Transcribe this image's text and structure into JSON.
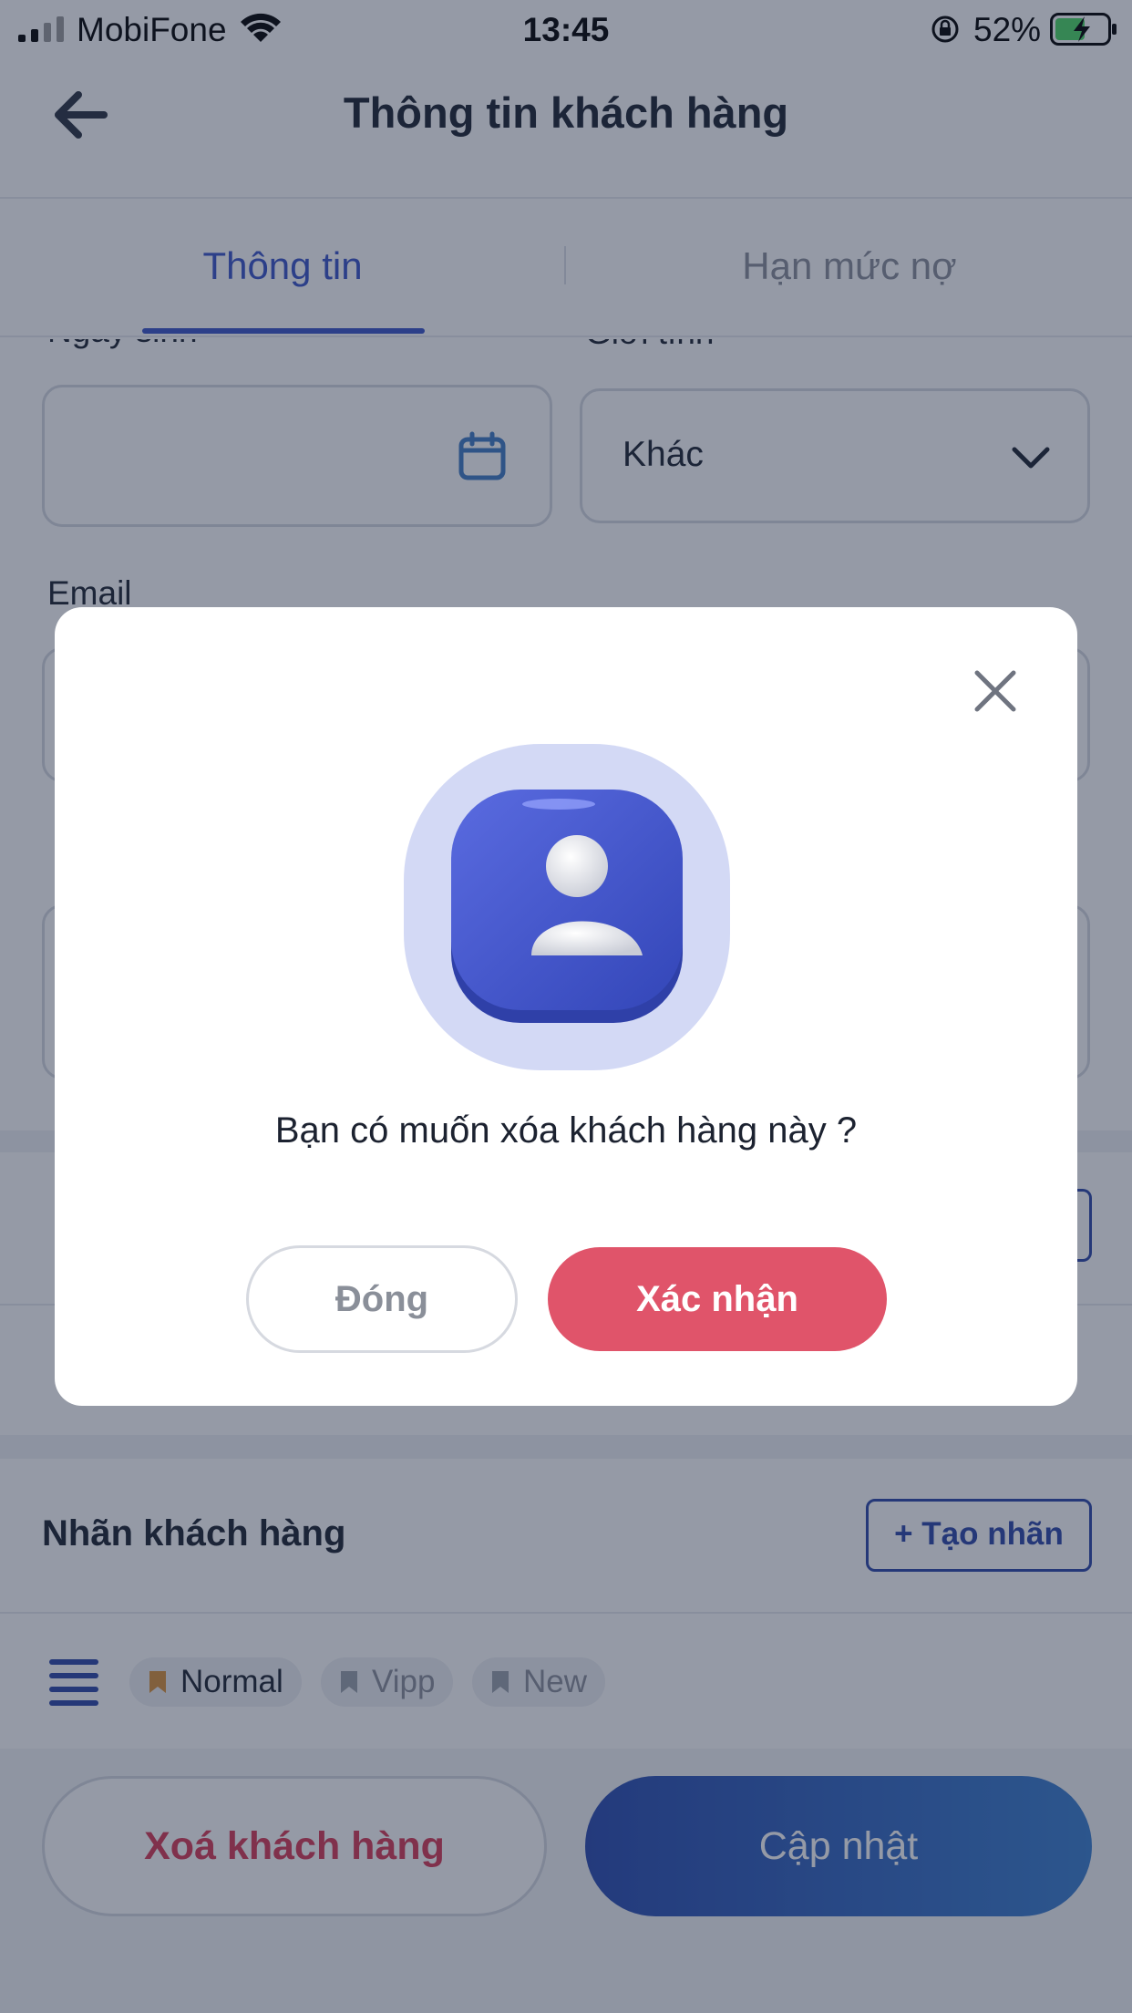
{
  "status_bar": {
    "carrier": "MobiFone",
    "time": "13:45",
    "battery": "52%"
  },
  "header": {
    "title": "Thông tin khách hàng"
  },
  "tabs": [
    {
      "label": "Thông tin",
      "active": true
    },
    {
      "label": "Hạn mức nợ",
      "active": false
    }
  ],
  "form": {
    "birthday_label": "Ngày sinh",
    "gender_label": "Giới tính",
    "gender_value": "Khác",
    "email_label": "Email"
  },
  "labels_section": {
    "title": "Nhãn khách hàng",
    "create_button": "+ Tạo nhãn",
    "tags": [
      {
        "label": "Normal",
        "color": "#d9913a"
      },
      {
        "label": "Vipp",
        "color": "#9aa0aa"
      },
      {
        "label": "New",
        "color": "#9aa0aa"
      }
    ]
  },
  "actions": {
    "delete_label": "Xoá khách hàng",
    "update_label": "Cập nhật"
  },
  "dialog": {
    "message": "Bạn có muốn xóa khách hàng này ?",
    "close_label": "Đóng",
    "confirm_label": "Xác nhận"
  },
  "colors": {
    "accent": "#3954c8",
    "danger": "#e0546a",
    "overlay": "rgba(30,40,65,0.47)"
  }
}
